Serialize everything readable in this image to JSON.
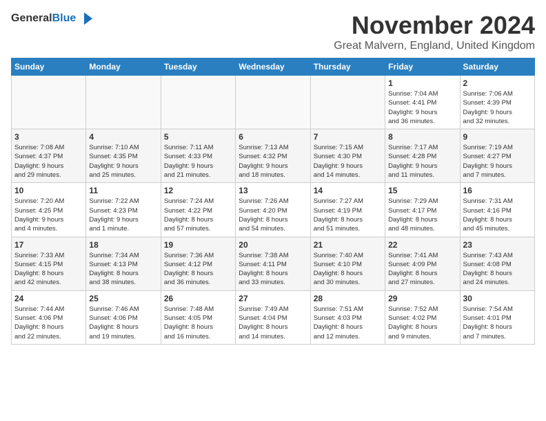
{
  "header": {
    "logo_general": "General",
    "logo_blue": "Blue",
    "month_title": "November 2024",
    "location": "Great Malvern, England, United Kingdom"
  },
  "weekdays": [
    "Sunday",
    "Monday",
    "Tuesday",
    "Wednesday",
    "Thursday",
    "Friday",
    "Saturday"
  ],
  "weeks": [
    [
      {
        "day": "",
        "info": ""
      },
      {
        "day": "",
        "info": ""
      },
      {
        "day": "",
        "info": ""
      },
      {
        "day": "",
        "info": ""
      },
      {
        "day": "",
        "info": ""
      },
      {
        "day": "1",
        "info": "Sunrise: 7:04 AM\nSunset: 4:41 PM\nDaylight: 9 hours\nand 36 minutes."
      },
      {
        "day": "2",
        "info": "Sunrise: 7:06 AM\nSunset: 4:39 PM\nDaylight: 9 hours\nand 32 minutes."
      }
    ],
    [
      {
        "day": "3",
        "info": "Sunrise: 7:08 AM\nSunset: 4:37 PM\nDaylight: 9 hours\nand 29 minutes."
      },
      {
        "day": "4",
        "info": "Sunrise: 7:10 AM\nSunset: 4:35 PM\nDaylight: 9 hours\nand 25 minutes."
      },
      {
        "day": "5",
        "info": "Sunrise: 7:11 AM\nSunset: 4:33 PM\nDaylight: 9 hours\nand 21 minutes."
      },
      {
        "day": "6",
        "info": "Sunrise: 7:13 AM\nSunset: 4:32 PM\nDaylight: 9 hours\nand 18 minutes."
      },
      {
        "day": "7",
        "info": "Sunrise: 7:15 AM\nSunset: 4:30 PM\nDaylight: 9 hours\nand 14 minutes."
      },
      {
        "day": "8",
        "info": "Sunrise: 7:17 AM\nSunset: 4:28 PM\nDaylight: 9 hours\nand 11 minutes."
      },
      {
        "day": "9",
        "info": "Sunrise: 7:19 AM\nSunset: 4:27 PM\nDaylight: 9 hours\nand 7 minutes."
      }
    ],
    [
      {
        "day": "10",
        "info": "Sunrise: 7:20 AM\nSunset: 4:25 PM\nDaylight: 9 hours\nand 4 minutes."
      },
      {
        "day": "11",
        "info": "Sunrise: 7:22 AM\nSunset: 4:23 PM\nDaylight: 9 hours\nand 1 minute."
      },
      {
        "day": "12",
        "info": "Sunrise: 7:24 AM\nSunset: 4:22 PM\nDaylight: 8 hours\nand 57 minutes."
      },
      {
        "day": "13",
        "info": "Sunrise: 7:26 AM\nSunset: 4:20 PM\nDaylight: 8 hours\nand 54 minutes."
      },
      {
        "day": "14",
        "info": "Sunrise: 7:27 AM\nSunset: 4:19 PM\nDaylight: 8 hours\nand 51 minutes."
      },
      {
        "day": "15",
        "info": "Sunrise: 7:29 AM\nSunset: 4:17 PM\nDaylight: 8 hours\nand 48 minutes."
      },
      {
        "day": "16",
        "info": "Sunrise: 7:31 AM\nSunset: 4:16 PM\nDaylight: 8 hours\nand 45 minutes."
      }
    ],
    [
      {
        "day": "17",
        "info": "Sunrise: 7:33 AM\nSunset: 4:15 PM\nDaylight: 8 hours\nand 42 minutes."
      },
      {
        "day": "18",
        "info": "Sunrise: 7:34 AM\nSunset: 4:13 PM\nDaylight: 8 hours\nand 38 minutes."
      },
      {
        "day": "19",
        "info": "Sunrise: 7:36 AM\nSunset: 4:12 PM\nDaylight: 8 hours\nand 36 minutes."
      },
      {
        "day": "20",
        "info": "Sunrise: 7:38 AM\nSunset: 4:11 PM\nDaylight: 8 hours\nand 33 minutes."
      },
      {
        "day": "21",
        "info": "Sunrise: 7:40 AM\nSunset: 4:10 PM\nDaylight: 8 hours\nand 30 minutes."
      },
      {
        "day": "22",
        "info": "Sunrise: 7:41 AM\nSunset: 4:09 PM\nDaylight: 8 hours\nand 27 minutes."
      },
      {
        "day": "23",
        "info": "Sunrise: 7:43 AM\nSunset: 4:08 PM\nDaylight: 8 hours\nand 24 minutes."
      }
    ],
    [
      {
        "day": "24",
        "info": "Sunrise: 7:44 AM\nSunset: 4:06 PM\nDaylight: 8 hours\nand 22 minutes."
      },
      {
        "day": "25",
        "info": "Sunrise: 7:46 AM\nSunset: 4:06 PM\nDaylight: 8 hours\nand 19 minutes."
      },
      {
        "day": "26",
        "info": "Sunrise: 7:48 AM\nSunset: 4:05 PM\nDaylight: 8 hours\nand 16 minutes."
      },
      {
        "day": "27",
        "info": "Sunrise: 7:49 AM\nSunset: 4:04 PM\nDaylight: 8 hours\nand 14 minutes."
      },
      {
        "day": "28",
        "info": "Sunrise: 7:51 AM\nSunset: 4:03 PM\nDaylight: 8 hours\nand 12 minutes."
      },
      {
        "day": "29",
        "info": "Sunrise: 7:52 AM\nSunset: 4:02 PM\nDaylight: 8 hours\nand 9 minutes."
      },
      {
        "day": "30",
        "info": "Sunrise: 7:54 AM\nSunset: 4:01 PM\nDaylight: 8 hours\nand 7 minutes."
      }
    ]
  ]
}
